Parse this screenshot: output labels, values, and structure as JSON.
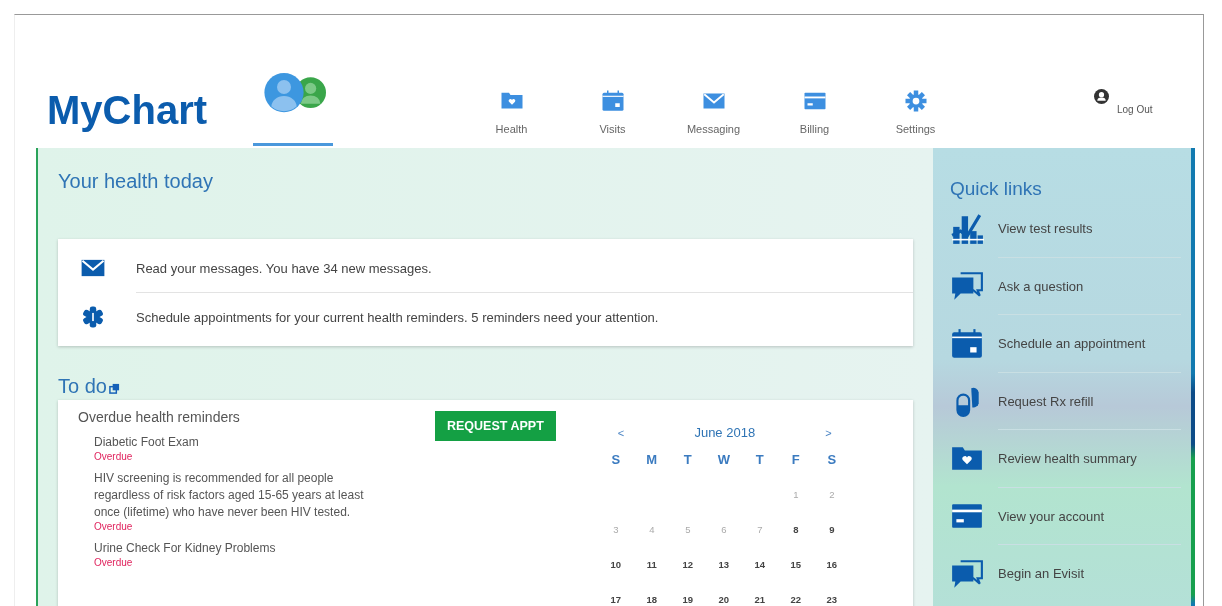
{
  "header": {
    "logo": "MyChart",
    "home_tab": {
      "selected": true
    },
    "nav": [
      {
        "label": "Health",
        "kind": "folder-heart",
        "selected": false
      },
      {
        "label": "Visits",
        "kind": "calendar",
        "selected": false
      },
      {
        "label": "Messaging",
        "kind": "envelope",
        "selected": false
      },
      {
        "label": "Billing",
        "kind": "card",
        "selected": false
      },
      {
        "label": "Settings",
        "kind": "gear",
        "selected": false
      }
    ],
    "logout": "Log Out"
  },
  "health_today": {
    "title": "Your health today",
    "items": [
      {
        "kind": "envelope",
        "text": "Read your messages. You have 34 new messages."
      },
      {
        "kind": "asterisk",
        "text": "Schedule appointments for your current health reminders. 5 reminders need your attention."
      }
    ]
  },
  "todo": {
    "title": "To do",
    "subtitle": "Overdue health reminders",
    "button": "REQUEST APPT",
    "reminders": [
      {
        "title": "Diabetic Foot Exam",
        "status": "Overdue"
      },
      {
        "title": "HIV screening is recommended for all people regardless of risk factors aged 15-65 years at least once (lifetime) who have never been HIV tested.",
        "status": "Overdue"
      },
      {
        "title": "Urine Check For Kidney Problems",
        "status": "Overdue"
      }
    ],
    "calendar": {
      "prev": "<",
      "month": "June 2018",
      "next": ">",
      "weekdays": [
        "S",
        "M",
        "T",
        "W",
        "T",
        "F",
        "S"
      ],
      "weeks": [
        [
          {
            "kind": "blank"
          },
          {
            "kind": "blank"
          },
          {
            "kind": "blank"
          },
          {
            "kind": "blank"
          },
          {
            "kind": "blank"
          },
          {
            "kind": "day",
            "day": "1",
            "dim": true
          },
          {
            "kind": "day",
            "day": "2",
            "dim": true
          }
        ],
        [
          {
            "kind": "day",
            "day": "3",
            "dim": true
          },
          {
            "kind": "day",
            "day": "4",
            "dim": true
          },
          {
            "kind": "day",
            "day": "5",
            "dim": true
          },
          {
            "kind": "day",
            "day": "6",
            "dim": true
          },
          {
            "kind": "day",
            "day": "7",
            "dim": true
          },
          {
            "kind": "day",
            "day": "8",
            "dim": false
          },
          {
            "kind": "day",
            "day": "9",
            "dim": false
          }
        ],
        [
          {
            "kind": "day",
            "day": "10",
            "dim": false
          },
          {
            "kind": "day",
            "day": "11",
            "dim": false
          },
          {
            "kind": "day",
            "day": "12",
            "dim": false
          },
          {
            "kind": "day",
            "day": "13",
            "dim": false
          },
          {
            "kind": "day",
            "day": "14",
            "dim": false
          },
          {
            "kind": "day",
            "day": "15",
            "dim": false
          },
          {
            "kind": "day",
            "day": "16",
            "dim": false
          }
        ],
        [
          {
            "kind": "day",
            "day": "17",
            "dim": false
          },
          {
            "kind": "day",
            "day": "18",
            "dim": false
          },
          {
            "kind": "day",
            "day": "19",
            "dim": false
          },
          {
            "kind": "day",
            "day": "20",
            "dim": false
          },
          {
            "kind": "day",
            "day": "21",
            "dim": false
          },
          {
            "kind": "day",
            "day": "22",
            "dim": false
          },
          {
            "kind": "day",
            "day": "23",
            "dim": false
          }
        ]
      ]
    }
  },
  "quick_links": {
    "title": "Quick links",
    "items": [
      {
        "kind": "chart",
        "label": "View test results"
      },
      {
        "kind": "chat",
        "label": "Ask a question"
      },
      {
        "kind": "calendar",
        "label": "Schedule an appointment"
      },
      {
        "kind": "pill",
        "label": "Request Rx refill"
      },
      {
        "kind": "folder-heart",
        "label": "Review health summary"
      },
      {
        "kind": "card",
        "label": "View your account"
      },
      {
        "kind": "chat",
        "label": "Begin an Evisit"
      }
    ]
  }
}
